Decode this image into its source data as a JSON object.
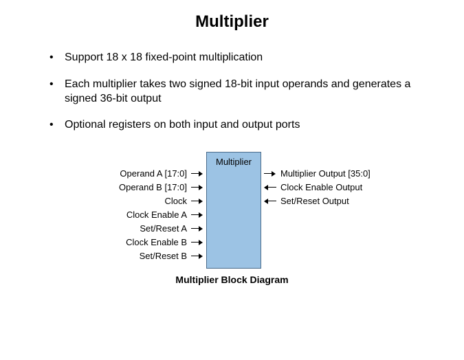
{
  "title": "Multiplier",
  "bullets": [
    "Support 18 x 18 fixed-point multiplication",
    "Each multiplier takes two signed 18-bit input operands and generates a signed 36-bit output",
    "Optional registers on both input and output ports"
  ],
  "diagram": {
    "block_label": "Multiplier",
    "caption": "Multiplier Block Diagram",
    "inputs": [
      "Operand A [17:0]",
      "Operand B [17:0]",
      "Clock",
      "Clock Enable A",
      "Set/Reset A",
      "Clock Enable B",
      "Set/Reset B"
    ],
    "outputs": [
      {
        "label": "Multiplier Output [35:0]",
        "dir": "out"
      },
      {
        "label": "Clock Enable Output",
        "dir": "in"
      },
      {
        "label": "Set/Reset Output",
        "dir": "in"
      }
    ]
  }
}
